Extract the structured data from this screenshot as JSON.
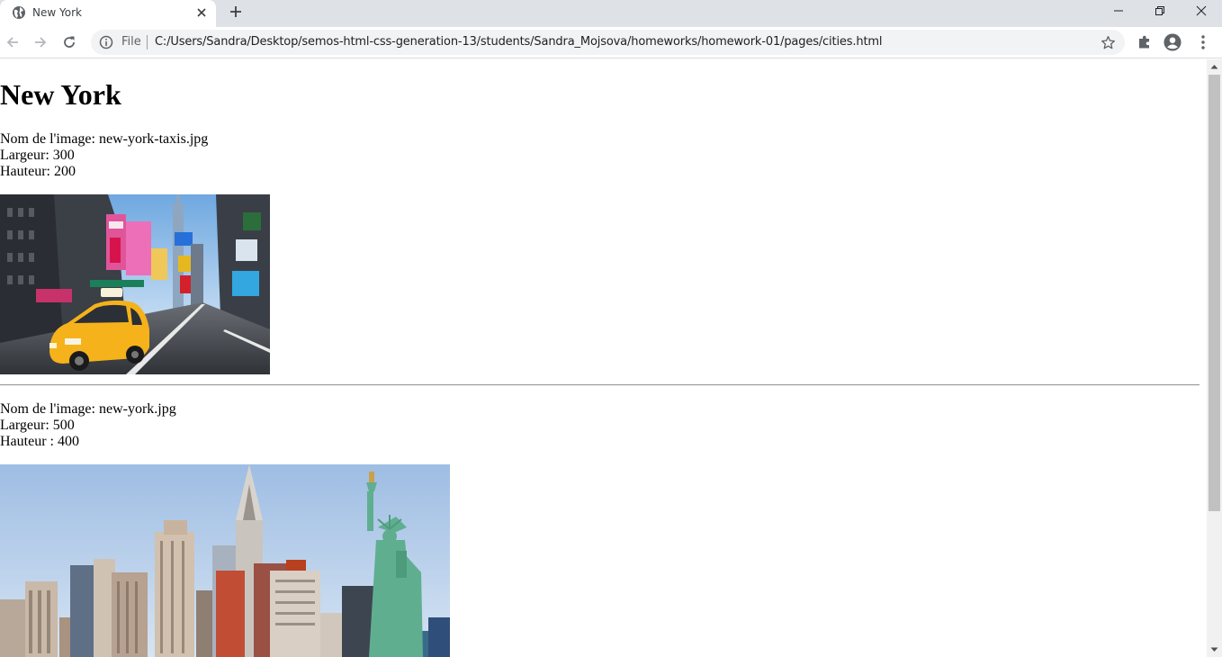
{
  "browser": {
    "tab_title": "New York",
    "omnibox": {
      "scheme": "File",
      "url": "C:/Users/Sandra/Desktop/semos-html-css-generation-13/students/Sandra_Mojsova/homeworks/homework-01/pages/cities.html"
    }
  },
  "page": {
    "heading": "New York",
    "images": [
      {
        "name_line": "Nom de l'image: new-york-taxis.jpg",
        "width_line": "Largeur: 300",
        "height_line": "Hauteur: 200",
        "caption": "",
        "shown_width": 300,
        "shown_height": 200
      },
      {
        "name_line": "Nom de l'image: new-york.jpg",
        "width_line": "Largeur: 500",
        "height_line": "Hauteur : 400",
        "caption": "",
        "shown_width": 500,
        "shown_height": 400
      }
    ]
  },
  "colors": {
    "tabstrip": "#dee1e6",
    "omnibox": "#f1f3f4",
    "taxi_yellow": "#f5b21b",
    "sky": "#a9c4e6",
    "statue_green": "#5fae90"
  },
  "icons": [
    "globe-icon",
    "close-icon",
    "plus-icon",
    "minimize-icon",
    "restore-icon",
    "window-close-icon",
    "back-arrow-icon",
    "forward-arrow-icon",
    "reload-icon",
    "info-icon",
    "star-icon",
    "puzzle-icon",
    "profile-icon",
    "kebab-menu-icon",
    "scroll-up-icon",
    "scroll-down-icon"
  ]
}
